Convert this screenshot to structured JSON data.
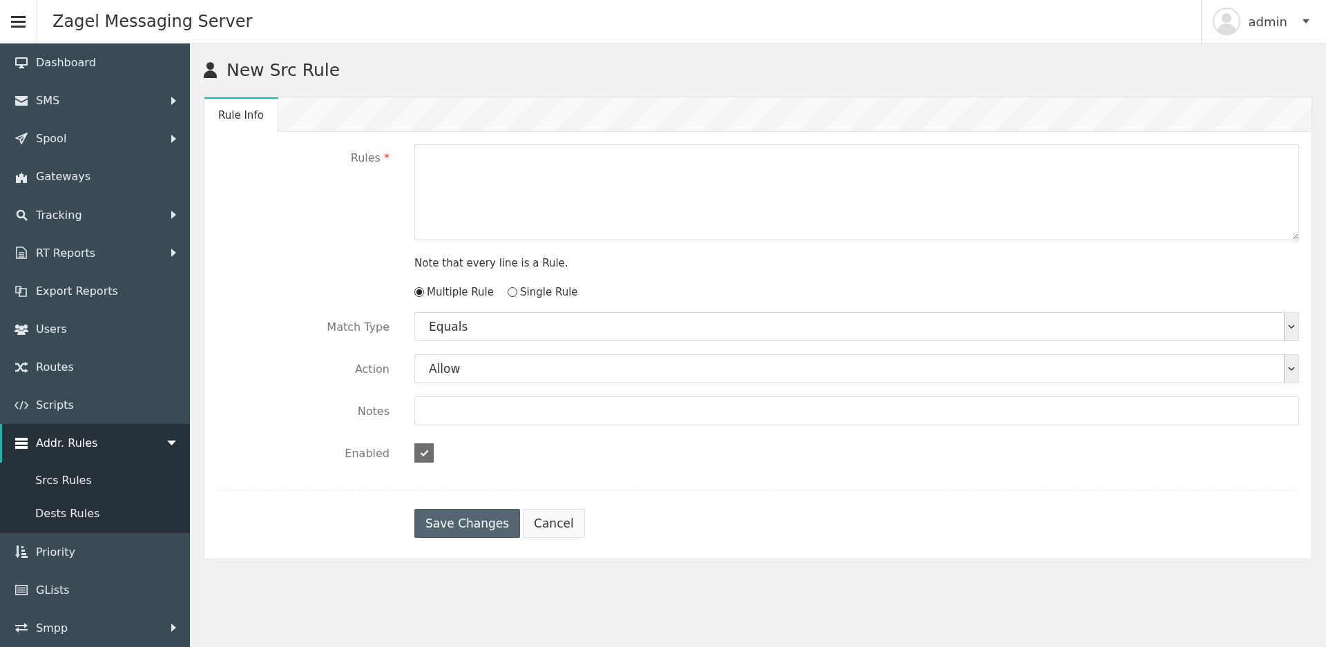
{
  "header": {
    "app_title": "Zagel Messaging Server",
    "user": {
      "name": "admin"
    }
  },
  "sidebar": {
    "items": [
      {
        "label": "Dashboard",
        "has_submenu": false,
        "expanded": false,
        "selected": false
      },
      {
        "label": "SMS",
        "has_submenu": true,
        "expanded": false,
        "selected": false
      },
      {
        "label": "Spool",
        "has_submenu": true,
        "expanded": false,
        "selected": false
      },
      {
        "label": "Gateways",
        "has_submenu": false,
        "expanded": false,
        "selected": false
      },
      {
        "label": "Tracking",
        "has_submenu": true,
        "expanded": false,
        "selected": false
      },
      {
        "label": "RT Reports",
        "has_submenu": true,
        "expanded": false,
        "selected": false
      },
      {
        "label": "Export Reports",
        "has_submenu": false,
        "expanded": false,
        "selected": false
      },
      {
        "label": "Users",
        "has_submenu": false,
        "expanded": false,
        "selected": false
      },
      {
        "label": "Routes",
        "has_submenu": false,
        "expanded": false,
        "selected": false
      },
      {
        "label": "Scripts",
        "has_submenu": false,
        "expanded": false,
        "selected": false
      },
      {
        "label": "Addr. Rules",
        "has_submenu": true,
        "expanded": true,
        "selected": true,
        "children": [
          {
            "label": "Srcs Rules",
            "selected": false
          },
          {
            "label": "Dests Rules",
            "selected": false
          }
        ]
      },
      {
        "label": "Priority",
        "has_submenu": false,
        "expanded": false,
        "selected": false
      },
      {
        "label": "GLists",
        "has_submenu": false,
        "expanded": false,
        "selected": false
      },
      {
        "label": "Smpp",
        "has_submenu": true,
        "expanded": false,
        "selected": false
      }
    ]
  },
  "page": {
    "title": "New Src Rule"
  },
  "tabs": [
    {
      "label": "Rule Info",
      "selected": true
    }
  ],
  "form": {
    "rules": {
      "label": "Rules",
      "required_mark": "*",
      "note": "Note that every line is a Rule."
    },
    "rule_mode": [
      {
        "label": "Multiple Rule",
        "selected": true
      },
      {
        "label": "Single Rule",
        "selected": false
      }
    ],
    "match_type": {
      "label": "Match Type",
      "value": "Equals"
    },
    "action": {
      "label": "Action",
      "value": "Allow"
    },
    "notes": {
      "label": "Notes"
    },
    "enabled": {
      "label": "Enabled",
      "checked": true
    }
  },
  "buttons": [
    {
      "label": "Save Changes",
      "kind": "primary"
    },
    {
      "label": "Cancel",
      "kind": "secondary"
    }
  ]
}
